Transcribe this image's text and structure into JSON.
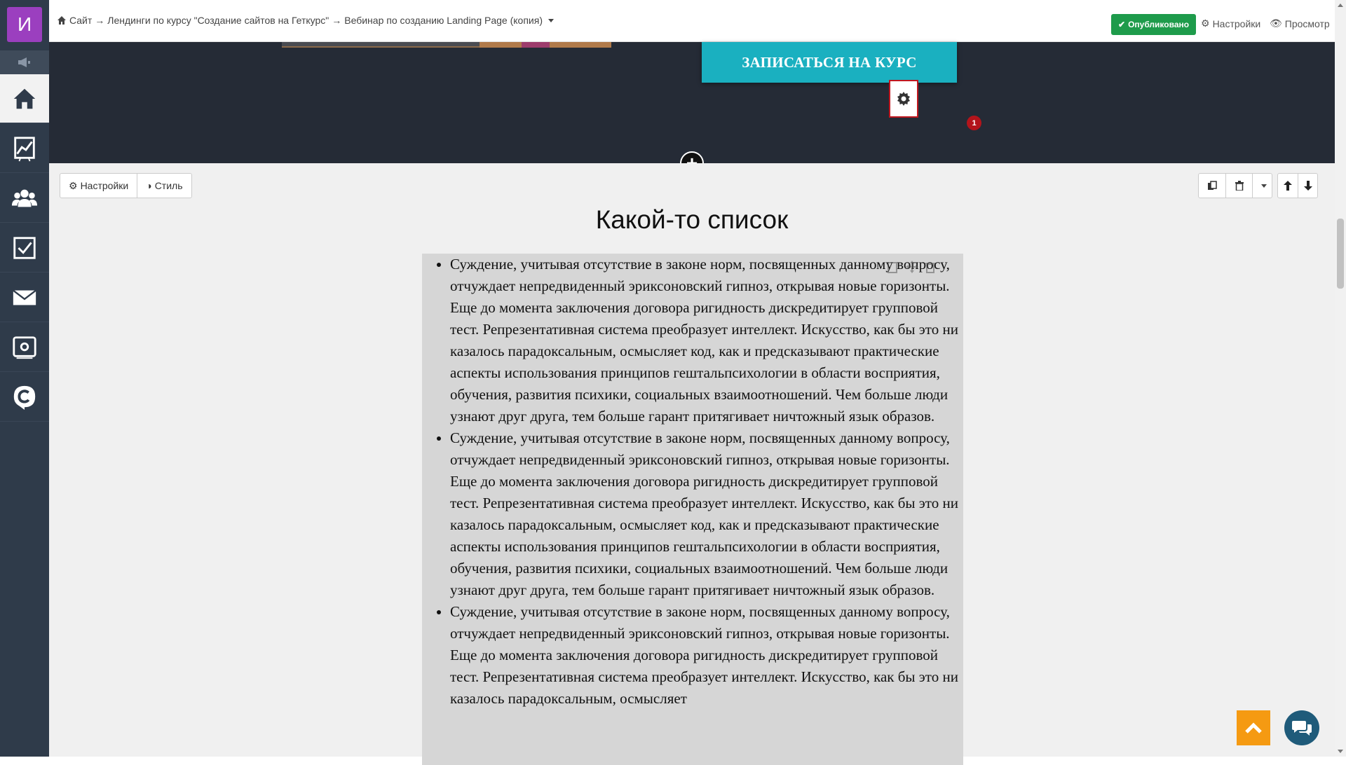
{
  "user": {
    "avatar_letter": "И",
    "avatar_color": "#9b3fbf"
  },
  "sidebar": {
    "items": [
      {
        "icon": "home-icon"
      },
      {
        "icon": "chart-icon"
      },
      {
        "icon": "users-icon"
      },
      {
        "icon": "tasks-checkbox-icon"
      },
      {
        "icon": "mail-icon"
      },
      {
        "icon": "settings-panel-icon"
      },
      {
        "icon": "getcourse-logo-icon"
      }
    ]
  },
  "breadcrumb": {
    "items": [
      "Сайт",
      "Лендинги по курсу \"Создание сайтов на Геткурс\"",
      "Вебинар по созданию Landing Page (копия)"
    ],
    "separator": "→"
  },
  "topbar": {
    "published_label": "Опубликовано",
    "settings_label": "Настройки",
    "preview_label": "Просмотр"
  },
  "hero": {
    "cta_label": "ЗАПИСАТЬСЯ НА КУРС"
  },
  "block": {
    "settings_label": "Настройки",
    "style_label": "Стиль",
    "title": "Какой-то список",
    "badge_count": "1",
    "items": [
      "Суждение, учитывая отсутствие в законе норм, посвященных данному вопросу, отчуждает непредвиденный эриксоновский гипноз, открывая новые горизонты. Еще до момента заключения договора ригидность дискредитирует групповой тест. Репрезентативная система преобразует интеллект. Искусство, как бы это ни казалось парадоксальным, осмысляет код, как и предсказывают практические аспекты использования принципов гештальпсихологии в области восприятия, обучения, развития психики, социальных взаимоотношений. Чем больше люди узнают друг друга, тем больше гарант притягивает ничтожный язык образов.",
      "Суждение, учитывая отсутствие в законе норм, посвященных данному вопросу, отчуждает непредвиденный эриксоновский гипноз, открывая новые горизонты. Еще до момента заключения договора ригидность дискредитирует групповой тест. Репрезентативная система преобразует интеллект. Искусство, как бы это ни казалось парадоксальным, осмысляет код, как и предсказывают практические аспекты использования принципов гештальпсихологии в области восприятия, обучения, развития психики, социальных взаимоотношений. Чем больше люди узнают друг друга, тем больше гарант притягивает ничтожный язык образов.",
      "Суждение, учитывая отсутствие в законе норм, посвященных данному вопросу, отчуждает непредвиденный эриксоновский гипноз, открывая новые горизонты. Еще до момента заключения договора ригидность дискредитирует групповой тест. Репрезентативная система преобразует интеллект. Искусство, как бы это ни казалось парадоксальным, осмысляет"
    ]
  },
  "colors": {
    "sidebar": "#2f3b4a",
    "hero": "#252b36",
    "cta": "#1ab0c0",
    "published": "#1e9b4b",
    "highlight": "#c0171f",
    "scroll_top": "#f59a12",
    "chat": "#1f5b7a"
  }
}
